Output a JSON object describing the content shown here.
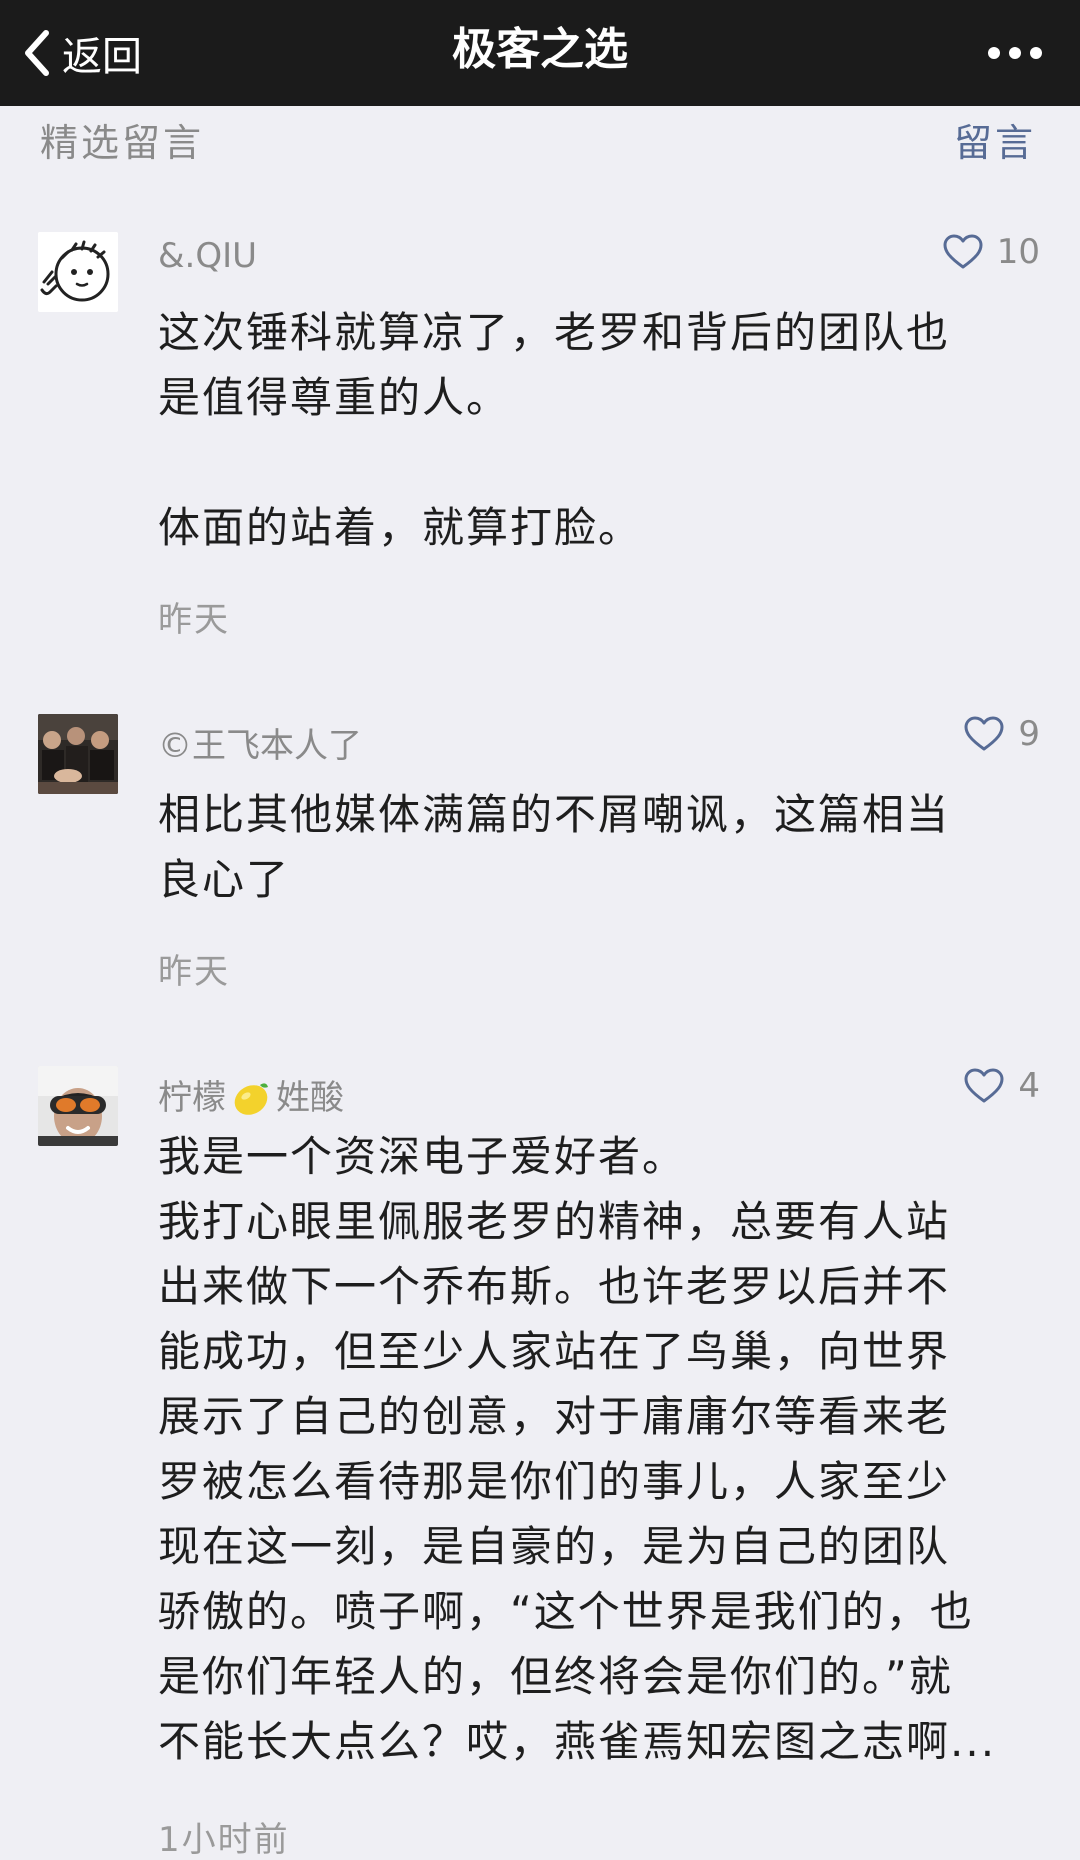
{
  "nav": {
    "back_label": "返回",
    "title": "极客之选"
  },
  "section": {
    "title": "精选留言",
    "action": "留言"
  },
  "comments": [
    {
      "nickname": "&.QIU",
      "likes": "10",
      "lines": [
        "这次锤科就算凉了，老罗和背后的团队也",
        "是值得尊重的人。",
        "",
        "体面的站着，就算打脸。"
      ],
      "time": "昨天"
    },
    {
      "nickname": "©王飞本人了",
      "likes": "9",
      "lines": [
        "相比其他媒体满篇的不屑嘲讽，这篇相当",
        "良心了"
      ],
      "time": "昨天"
    },
    {
      "nickname_part1": "柠檬",
      "nickname_emoji": "lemon-emoji",
      "nickname_part2": "姓酸",
      "likes": "4",
      "lines": [
        "我是一个资深电子爱好者。",
        "我打心眼里佩服老罗的精神，总要有人站",
        "出来做下一个乔布斯。也许老罗以后并不",
        "能成功，但至少人家站在了鸟巢，向世界",
        "展示了自己的创意，对于庸庸尔等看来老",
        "罗被怎么看待那是你们的事儿，人家至少",
        "现在这一刻，是自豪的，是为自己的团队",
        "骄傲的。喷子啊，“这个世界是我们的，也",
        "是你们年轻人的，但终将会是你们的。”就",
        "不能长大点么？哎，燕雀焉知宏图之志啊..."
      ],
      "time": "1小时前"
    }
  ],
  "icons": {
    "back": "chevron-left-icon",
    "more": "more-dots-icon",
    "like": "heart-outline-icon"
  },
  "colors": {
    "navbar": "#1b1b1b",
    "background": "#efeff4",
    "link": "#576b95",
    "meta": "#8a8a8a",
    "text": "#1e1e1e"
  }
}
